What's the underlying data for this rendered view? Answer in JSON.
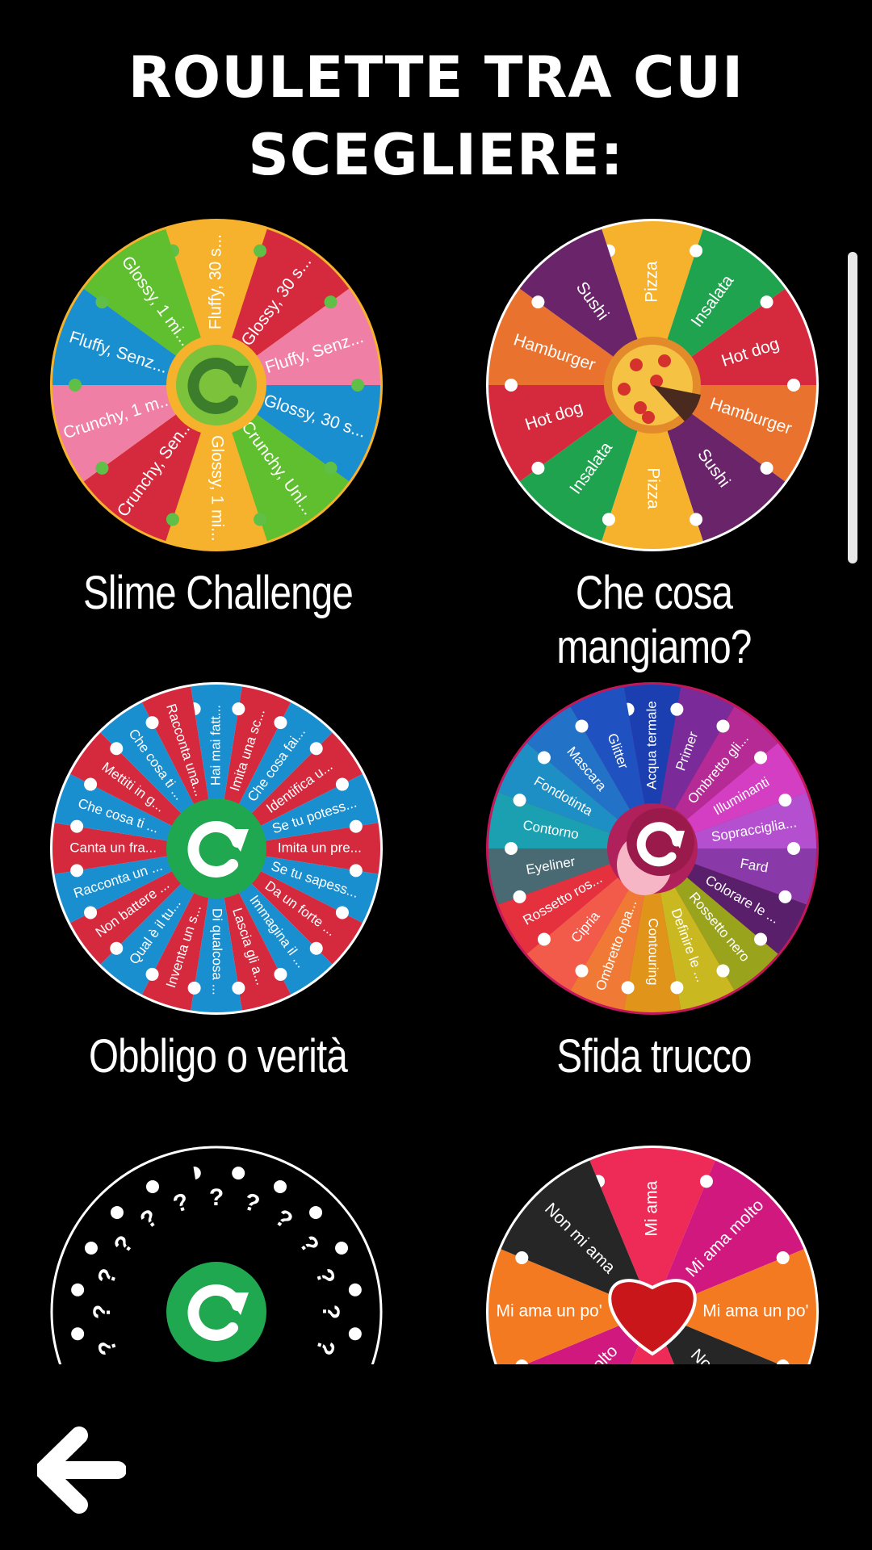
{
  "header": {
    "title_line1": "Roulette tra cui",
    "title_line2": "scegliere:"
  },
  "wheels": [
    {
      "label": "Slime Challenge",
      "center": "refresh-slime",
      "rim": "#f6b22c",
      "dots": "#5fbf47",
      "segments": [
        {
          "text": "Fluffy, 30 s...",
          "color": "#f6b22c"
        },
        {
          "text": "Glossy, 30 s...",
          "color": "#d52a3e"
        },
        {
          "text": "Fluffy, Senz...",
          "color": "#f07fa6"
        },
        {
          "text": "Glossy, 30 s...",
          "color": "#1a8fd0"
        },
        {
          "text": "Crunchy, Unl...",
          "color": "#5fbf2e"
        },
        {
          "text": "Glossy, 1 mi...",
          "color": "#f6b22c"
        },
        {
          "text": "Crunchy, Sen...",
          "color": "#d52a3e"
        },
        {
          "text": "Crunchy, 1 m...",
          "color": "#f07fa6"
        },
        {
          "text": "Fluffy, Senz...",
          "color": "#1a8fd0"
        },
        {
          "text": "Glossy, 1 mi...",
          "color": "#5fbf2e"
        }
      ]
    },
    {
      "label": "Che cosa mangiamo?",
      "center": "pizza",
      "rim": "#ffffff",
      "dots": "#ffffff",
      "segments": [
        {
          "text": "Pizza",
          "color": "#f6b22c"
        },
        {
          "text": "Insalata",
          "color": "#20a34f"
        },
        {
          "text": "Hot dog",
          "color": "#d52a3e"
        },
        {
          "text": "Hamburger",
          "color": "#e8722e"
        },
        {
          "text": "Sushi",
          "color": "#6a2469"
        },
        {
          "text": "Pizza",
          "color": "#f6b22c"
        },
        {
          "text": "Insalata",
          "color": "#20a34f"
        },
        {
          "text": "Hot dog",
          "color": "#d52a3e"
        },
        {
          "text": "Hamburger",
          "color": "#e8722e"
        },
        {
          "text": "Sushi",
          "color": "#6a2469"
        }
      ]
    },
    {
      "label": "Obbligo o verità",
      "center": "refresh-green",
      "rim": "#ffffff",
      "dots": "#ffffff",
      "segments": [
        {
          "text": "Hai mai fatt...",
          "color": "#1a8fd0"
        },
        {
          "text": "Imita una sc...",
          "color": "#d52a3e"
        },
        {
          "text": "Che cosa fai...",
          "color": "#1a8fd0"
        },
        {
          "text": "Identifica u...",
          "color": "#d52a3e"
        },
        {
          "text": "Se tu potess...",
          "color": "#1a8fd0"
        },
        {
          "text": "Imita un pre...",
          "color": "#d52a3e"
        },
        {
          "text": "Se tu sapess...",
          "color": "#1a8fd0"
        },
        {
          "text": "Da un forte ...",
          "color": "#d52a3e"
        },
        {
          "text": "Immagina il ...",
          "color": "#1a8fd0"
        },
        {
          "text": "Lascia gli a...",
          "color": "#d52a3e"
        },
        {
          "text": "Di qualcosa ...",
          "color": "#1a8fd0"
        },
        {
          "text": "Inventa un s...",
          "color": "#d52a3e"
        },
        {
          "text": "Qual è il tu...",
          "color": "#1a8fd0"
        },
        {
          "text": "Non battere ...",
          "color": "#d52a3e"
        },
        {
          "text": "Racconta un ...",
          "color": "#1a8fd0"
        },
        {
          "text": "Canta un fra...",
          "color": "#d52a3e"
        },
        {
          "text": "Che cosa ti ...",
          "color": "#1a8fd0"
        },
        {
          "text": "Mettiti in g...",
          "color": "#d52a3e"
        },
        {
          "text": "Che cosa ti ...",
          "color": "#1a8fd0"
        },
        {
          "text": "Racconta una...",
          "color": "#d52a3e"
        }
      ]
    },
    {
      "label": "Sfida trucco",
      "center": "lips",
      "rim": "#c2185b",
      "dots": "#ffffff",
      "segments": [
        {
          "text": "Acqua termale",
          "color": "#1b3fb0"
        },
        {
          "text": "Primer",
          "color": "#7b2a9a"
        },
        {
          "text": "Ombretto gli...",
          "color": "#b52a94"
        },
        {
          "text": "Illuminanti",
          "color": "#d33ec2"
        },
        {
          "text": "Sopracciglia...",
          "color": "#b44fd0"
        },
        {
          "text": "Fard",
          "color": "#8a3aa8"
        },
        {
          "text": "Colorare le ...",
          "color": "#5a1f6a"
        },
        {
          "text": "Rossetto nero",
          "color": "#9aa31c"
        },
        {
          "text": "Definire le ...",
          "color": "#c9b81f"
        },
        {
          "text": "Contouring",
          "color": "#e0951a"
        },
        {
          "text": "Ombretto opa...",
          "color": "#f07a35"
        },
        {
          "text": "Cipria",
          "color": "#f25a4a"
        },
        {
          "text": "Rossetto ros...",
          "color": "#e5303e"
        },
        {
          "text": "Eyeliner",
          "color": "#4a6a73"
        },
        {
          "text": "Contorno",
          "color": "#1aa0b0"
        },
        {
          "text": "Fondotinta",
          "color": "#1e8fc4"
        },
        {
          "text": "Mascara",
          "color": "#2272c8"
        },
        {
          "text": "Glitter",
          "color": "#1f52c0"
        }
      ]
    },
    {
      "label": "",
      "center": "refresh-green",
      "rim": "#ffffff",
      "dots": "#ffffff",
      "segments": [
        {
          "text": "?",
          "color": "#000000"
        },
        {
          "text": "?",
          "color": "#000000"
        },
        {
          "text": "?",
          "color": "#000000"
        },
        {
          "text": "?",
          "color": "#000000"
        },
        {
          "text": "?",
          "color": "#000000"
        },
        {
          "text": "?",
          "color": "#000000"
        },
        {
          "text": "?",
          "color": "#000000"
        },
        {
          "text": "?",
          "color": "#000000"
        },
        {
          "text": "?",
          "color": "#000000"
        },
        {
          "text": "?",
          "color": "#000000"
        },
        {
          "text": "?",
          "color": "#000000"
        },
        {
          "text": "?",
          "color": "#000000"
        },
        {
          "text": "?",
          "color": "#000000"
        },
        {
          "text": "?",
          "color": "#000000"
        },
        {
          "text": "?",
          "color": "#000000"
        },
        {
          "text": "?",
          "color": "#000000"
        },
        {
          "text": "?",
          "color": "#000000"
        },
        {
          "text": "?",
          "color": "#000000"
        },
        {
          "text": "?",
          "color": "#000000"
        },
        {
          "text": "?",
          "color": "#000000"
        }
      ]
    },
    {
      "label": "",
      "center": "heart",
      "rim": "#ffffff",
      "dots": "#ffffff",
      "segments": [
        {
          "text": "Mi ama",
          "color": "#ee2a57"
        },
        {
          "text": "Mi ama molto",
          "color": "#d0187f"
        },
        {
          "text": "Mi ama un po'",
          "color": "#f47a22"
        },
        {
          "text": "Non mi ama",
          "color": "#262626"
        },
        {
          "text": "Mi ama",
          "color": "#ee2a57"
        },
        {
          "text": "Mi ama molto",
          "color": "#d0187f"
        },
        {
          "text": "Mi ama un po'",
          "color": "#f47a22"
        },
        {
          "text": "Non mi ama",
          "color": "#262626"
        }
      ]
    }
  ],
  "footer": {
    "back_icon": "arrow-left-icon"
  }
}
